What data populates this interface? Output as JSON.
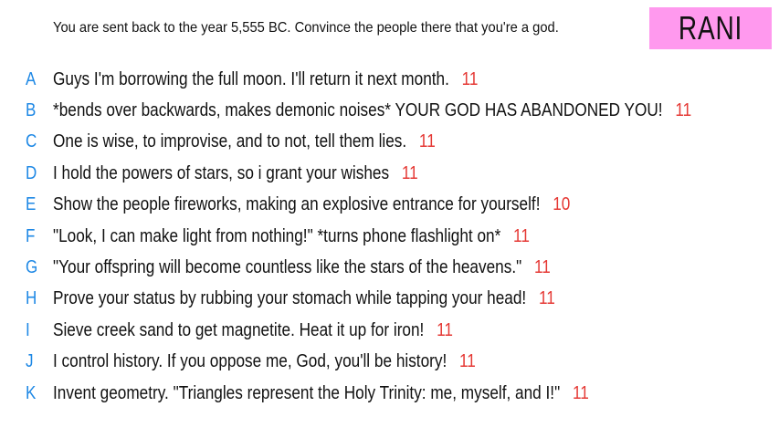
{
  "prompt": "You are sent back to the year 5,555 BC. Convince the people there that you're a god.",
  "player": {
    "name": "RANI",
    "tag_color": "#ff99ee"
  },
  "colors": {
    "letter": "#1e88e5",
    "score": "#e53935"
  },
  "answers": [
    {
      "letter": "A",
      "text": "Guys I'm borrowing the full moon. I'll return it next month.",
      "score": "11"
    },
    {
      "letter": "B",
      "text": "*bends over backwards, makes demonic noises* YOUR GOD HAS ABANDONED YOU!",
      "score": "11"
    },
    {
      "letter": "C",
      "text": "One is wise, to improvise, and to not, tell them lies.",
      "score": "11"
    },
    {
      "letter": "D",
      "text": "I hold the powers of stars, so i grant your wishes",
      "score": "11"
    },
    {
      "letter": "E",
      "text": "Show the people fireworks, making an explosive entrance for yourself!",
      "score": "10"
    },
    {
      "letter": "F",
      "text": "\"Look, I can make light from nothing!\" *turns phone flashlight on*",
      "score": "11"
    },
    {
      "letter": "G",
      "text": "\"Your offspring will become countless like the stars of the heavens.\"",
      "score": "11"
    },
    {
      "letter": "H",
      "text": "Prove your status by rubbing your stomach while tapping your head!",
      "score": "11"
    },
    {
      "letter": "I",
      "text": "Sieve creek sand to get magnetite. Heat it up for iron!",
      "score": "11"
    },
    {
      "letter": "J",
      "text": "I control history. If you oppose me, God, you'll be history!",
      "score": "11"
    },
    {
      "letter": "K",
      "text": "Invent geometry. \"Triangles represent the Holy Trinity: me, myself, and I!\"",
      "score": "11"
    }
  ]
}
